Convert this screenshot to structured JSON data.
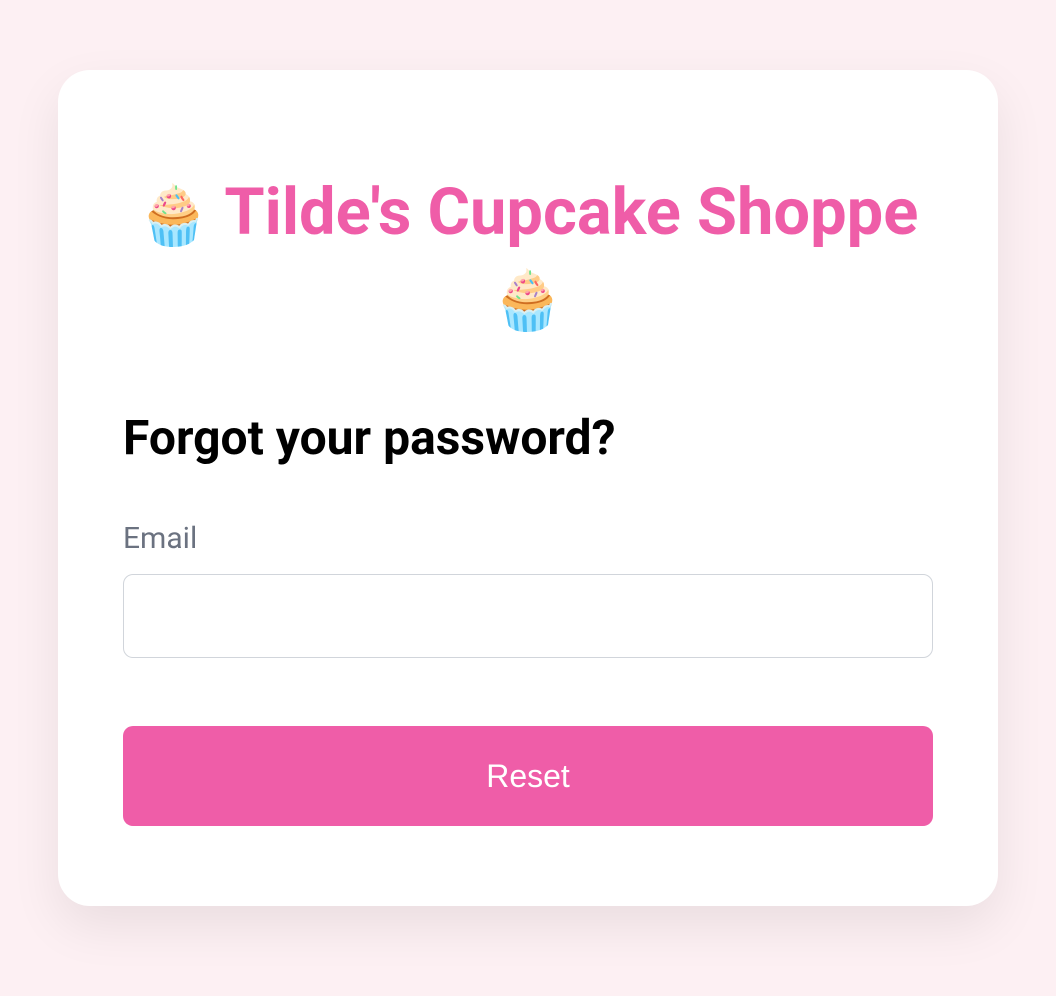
{
  "brand": {
    "icon_left": "🧁",
    "title": "Tilde's Cupcake Shoppe",
    "icon_right": "🧁"
  },
  "form": {
    "heading": "Forgot your password?",
    "email_label": "Email",
    "email_value": "",
    "submit_label": "Reset"
  },
  "colors": {
    "accent": "#ef5da8",
    "page_bg": "#fdf0f3",
    "card_bg": "#ffffff",
    "label": "#6b7280",
    "border": "#d1d5db"
  }
}
